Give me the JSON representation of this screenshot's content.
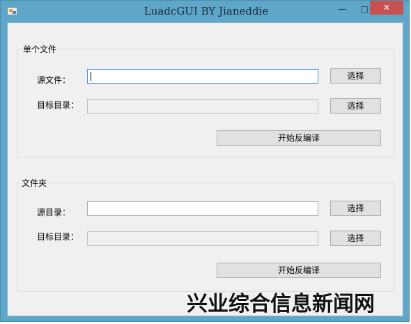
{
  "window": {
    "title": "LuadcGUI BY Jianeddie",
    "controls": {
      "minimize": "—",
      "maximize": "□",
      "close": "✕"
    }
  },
  "single_file_group": {
    "title": "单个文件",
    "source_label": "源文件：",
    "source_value": "",
    "target_label": "目标目录：",
    "target_value": "",
    "browse_source": "选择",
    "browse_target": "选择",
    "decompile_button": "开始反编译"
  },
  "folder_group": {
    "title": "文件夹",
    "source_label": "源目录：",
    "source_value": "",
    "target_label": "目标目录：",
    "target_value": "",
    "browse_source": "选择",
    "browse_target": "选择",
    "decompile_button": "开始反编译"
  },
  "watermark": {
    "text": "兴业综合信息新闻网"
  }
}
